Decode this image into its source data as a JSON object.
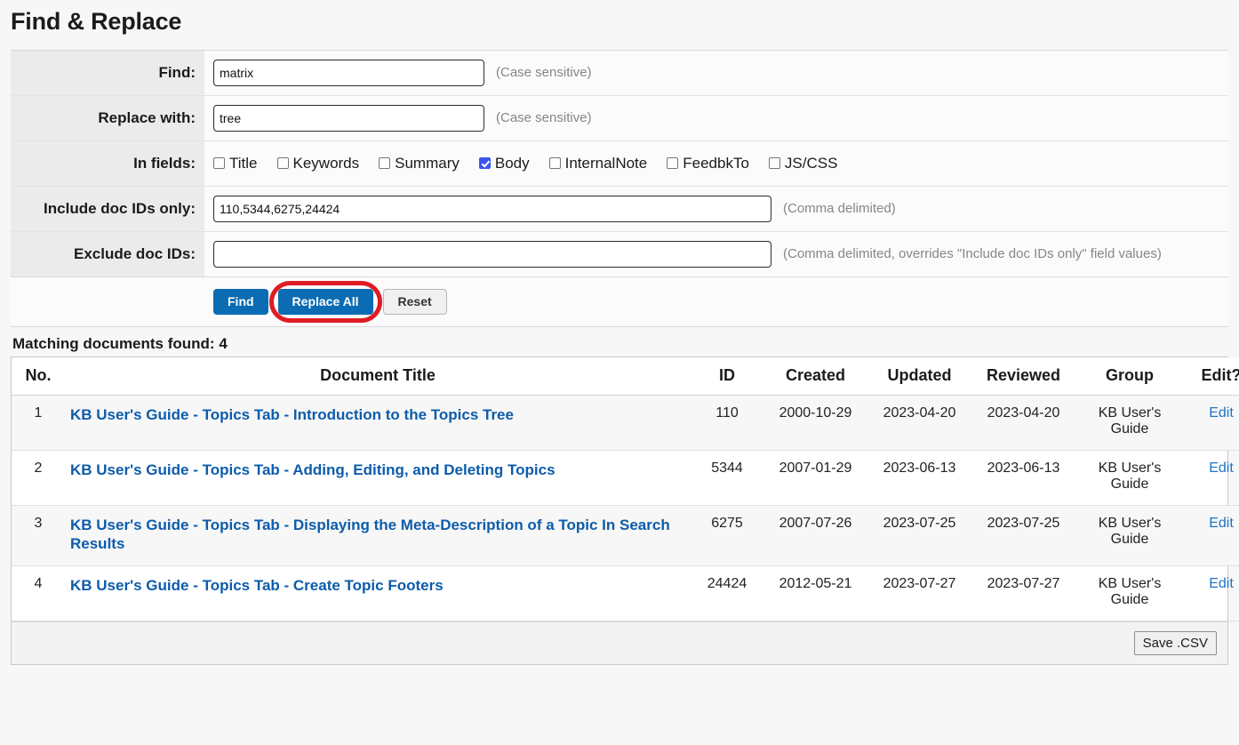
{
  "page": {
    "title": "Find & Replace"
  },
  "form": {
    "find": {
      "label": "Find:",
      "value": "matrix",
      "hint": "(Case sensitive)"
    },
    "replace": {
      "label": "Replace with:",
      "value": "tree",
      "hint": "(Case sensitive)"
    },
    "in_fields": {
      "label": "In fields:",
      "options": [
        {
          "label": "Title",
          "checked": false
        },
        {
          "label": "Keywords",
          "checked": false
        },
        {
          "label": "Summary",
          "checked": false
        },
        {
          "label": "Body",
          "checked": true
        },
        {
          "label": "InternalNote",
          "checked": false
        },
        {
          "label": "FeedbkTo",
          "checked": false
        },
        {
          "label": "JS/CSS",
          "checked": false
        }
      ]
    },
    "include_ids": {
      "label": "Include doc IDs only:",
      "value": "110,5344,6275,24424",
      "hint": "(Comma delimited)"
    },
    "exclude_ids": {
      "label": "Exclude doc IDs:",
      "value": "",
      "hint": "(Comma delimited, overrides \"Include doc IDs only\" field values)"
    }
  },
  "buttons": {
    "find": "Find",
    "replace_all": "Replace All",
    "reset": "Reset",
    "save_csv": "Save .CSV"
  },
  "highlight": {
    "target": "replace-all-button",
    "color": "#e01b24"
  },
  "results": {
    "summary": "Matching documents found: 4",
    "columns": [
      "No.",
      "Document Title",
      "ID",
      "Created",
      "Updated",
      "Reviewed",
      "Group",
      "Edit?"
    ],
    "rows": [
      {
        "no": "1",
        "title": "KB User's Guide - Topics Tab - Introduction to the Topics Tree",
        "id": "110",
        "created": "2000-10-29",
        "updated": "2023-04-20",
        "reviewed": "2023-04-20",
        "group": "KB User's Guide",
        "edit": "Edit"
      },
      {
        "no": "2",
        "title": "KB User's Guide - Topics Tab - Adding, Editing, and Deleting Topics",
        "id": "5344",
        "created": "2007-01-29",
        "updated": "2023-06-13",
        "reviewed": "2023-06-13",
        "group": "KB User's Guide",
        "edit": "Edit"
      },
      {
        "no": "3",
        "title": "KB User's Guide - Topics Tab - Displaying the Meta-Description of a Topic In Search Results",
        "id": "6275",
        "created": "2007-07-26",
        "updated": "2023-07-25",
        "reviewed": "2023-07-25",
        "group": "KB User's Guide",
        "edit": "Edit"
      },
      {
        "no": "4",
        "title": "KB User's Guide - Topics Tab - Create Topic Footers",
        "id": "24424",
        "created": "2012-05-21",
        "updated": "2023-07-27",
        "reviewed": "2023-07-27",
        "group": "KB User's Guide",
        "edit": "Edit"
      }
    ]
  },
  "colors": {
    "link": "#0d5cab",
    "primary_button": "#0c6cb3",
    "checkbox_checked": "#3b56e8",
    "highlight_ring": "#e01b24"
  }
}
